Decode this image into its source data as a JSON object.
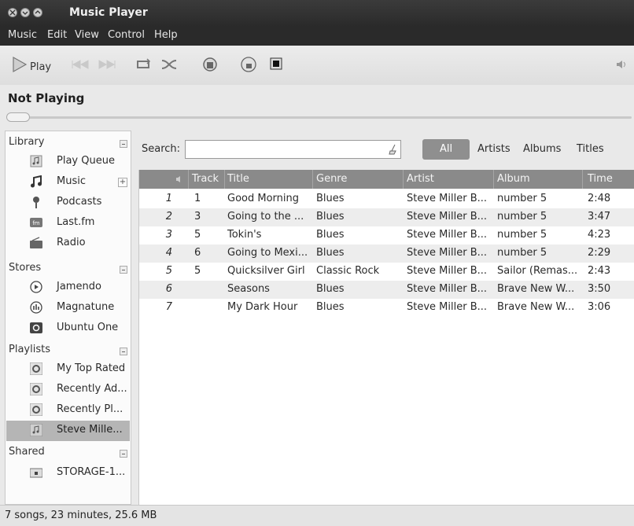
{
  "window": {
    "title": "Music Player"
  },
  "menu": [
    "Music",
    "Edit",
    "View",
    "Control",
    "Help"
  ],
  "toolbar": {
    "play_label": "Play"
  },
  "now_playing": "Not Playing",
  "sidebar": {
    "sections": [
      {
        "header": "Library",
        "items": [
          {
            "label": "Play Queue",
            "icon": "queue-icon"
          },
          {
            "label": "Music",
            "icon": "music-note-icon"
          },
          {
            "label": "Podcasts",
            "icon": "podcast-icon"
          },
          {
            "label": "Last.fm",
            "icon": "lastfm-icon"
          },
          {
            "label": "Radio",
            "icon": "radio-icon"
          }
        ]
      },
      {
        "header": "Stores",
        "items": [
          {
            "label": "Jamendo",
            "icon": "jamendo-icon"
          },
          {
            "label": "Magnatune",
            "icon": "magnatune-icon"
          },
          {
            "label": "Ubuntu One",
            "icon": "ubuntu-one-icon"
          }
        ]
      },
      {
        "header": "Playlists",
        "items": [
          {
            "label": "My Top Rated",
            "icon": "smart-playlist-icon"
          },
          {
            "label": "Recently Ad...",
            "icon": "smart-playlist-icon"
          },
          {
            "label": "Recently Pl...",
            "icon": "smart-playlist-icon"
          },
          {
            "label": "Steve Mille...",
            "icon": "playlist-icon",
            "selected": true
          }
        ]
      },
      {
        "header": "Shared",
        "items": [
          {
            "label": "STORAGE-1...",
            "icon": "network-share-icon"
          }
        ]
      }
    ]
  },
  "search": {
    "label": "Search:",
    "value": ""
  },
  "filters": {
    "all": "All",
    "artists": "Artists",
    "albums": "Albums",
    "titles": "Titles"
  },
  "table": {
    "columns": [
      "Track",
      "Title",
      "Genre",
      "Artist",
      "Album",
      "Time"
    ],
    "rows": [
      {
        "n": "1",
        "track": "1",
        "title": "Good Morning",
        "genre": "Blues",
        "artist": "Steve Miller B...",
        "album": "number 5",
        "time": "2:48"
      },
      {
        "n": "2",
        "track": "3",
        "title": "Going to the ...",
        "genre": "Blues",
        "artist": "Steve Miller B...",
        "album": "number 5",
        "time": "3:47"
      },
      {
        "n": "3",
        "track": "5",
        "title": "Tokin's",
        "genre": "Blues",
        "artist": "Steve Miller B...",
        "album": "number 5",
        "time": "4:23"
      },
      {
        "n": "4",
        "track": "6",
        "title": "Going to Mexi...",
        "genre": "Blues",
        "artist": "Steve Miller B...",
        "album": "number 5",
        "time": "2:29"
      },
      {
        "n": "5",
        "track": "5",
        "title": "Quicksilver Girl",
        "genre": "Classic Rock",
        "artist": "Steve Miller B...",
        "album": "Sailor (Remas...",
        "time": "2:43"
      },
      {
        "n": "6",
        "track": "",
        "title": "Seasons",
        "genre": "Blues",
        "artist": "Steve Miller B...",
        "album": "Brave New W...",
        "time": "3:50"
      },
      {
        "n": "7",
        "track": "",
        "title": "My Dark Hour",
        "genre": "Blues",
        "artist": "Steve Miller B...",
        "album": "Brave New W...",
        "time": "3:06"
      }
    ]
  },
  "status": "7 songs, 23 minutes, 25.6 MB"
}
